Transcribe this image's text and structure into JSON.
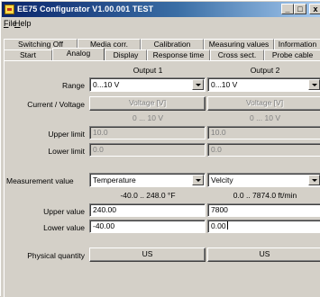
{
  "window": {
    "title": "EE75 Configurator V1.00.001 TEST",
    "controls": {
      "minimize": "_",
      "maximize": "□",
      "close": "x"
    }
  },
  "menu": [
    {
      "label": "File",
      "hotkey": "F"
    },
    {
      "label": "Help",
      "hotkey": "H"
    }
  ],
  "tabs": {
    "row1": [
      "Switching Off",
      "Media corr.",
      "Calibration",
      "Measuring values",
      "Information"
    ],
    "row2": [
      "Start",
      "Analog",
      "Display",
      "Response time",
      "Cross sect.",
      "Probe cable"
    ],
    "active": "Analog"
  },
  "analog": {
    "output1_header": "Output 1",
    "output2_header": "Output 2",
    "range": {
      "label": "Range",
      "output1": "0...10 V",
      "output2": "0...10 V"
    },
    "current_voltage": {
      "label": "Current / Voltage",
      "output1_button": "Voltage [V]",
      "output2_button": "Voltage [V]",
      "output1_range": "0 ... 10 V",
      "output2_range": "0 ... 10 V"
    },
    "upper_limit": {
      "label": "Upper limit",
      "output1": "10.0",
      "output2": "10.0"
    },
    "lower_limit": {
      "label": "Lower limit",
      "output1": "0.0",
      "output2": "0.0"
    },
    "measurement_value": {
      "label": "Measurement value",
      "output1": "Temperature",
      "output2": "Velcity",
      "output1_range": "-40.0 .. 248.0 °F",
      "output2_range": "0.0 .. 7874.0 ft/min"
    },
    "upper_value": {
      "label": "Upper value",
      "output1": "240.00",
      "output2": "7800"
    },
    "lower_value": {
      "label": "Lower value",
      "output1": "-40.00",
      "output2": "0.00"
    },
    "physical_quantity": {
      "label": "Physical quantity",
      "output1_button": "US",
      "output2_button": "US"
    }
  }
}
